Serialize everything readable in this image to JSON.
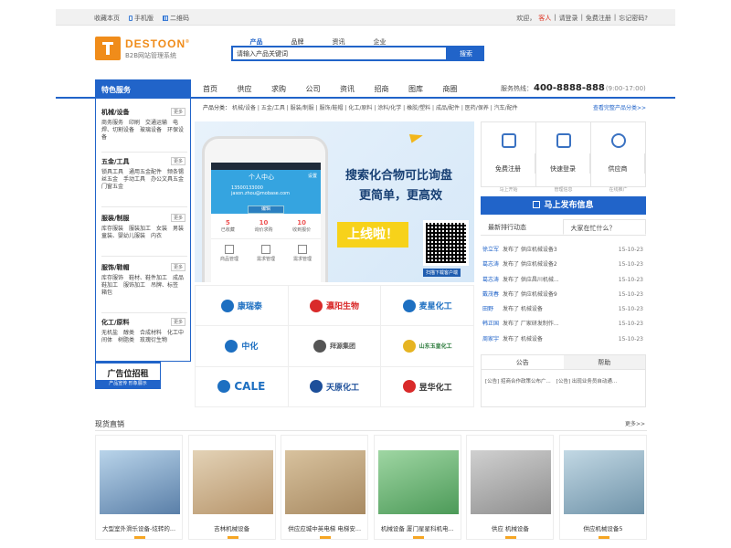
{
  "topbar": {
    "left": [
      "收藏本页",
      "手机版",
      "二维码"
    ],
    "welcome": "欢迎，",
    "guest": "客人",
    "links": [
      "请登录",
      "免费注册",
      "忘记密码?"
    ],
    "sep": "|"
  },
  "logo": {
    "name": "DESTOON",
    "reg": "®",
    "sub": "B2B网站管理系统"
  },
  "search": {
    "tabs": [
      "产品",
      "品牌",
      "资讯",
      "企业"
    ],
    "placeholder": "请输入产品关键词",
    "button": "搜索"
  },
  "nav": {
    "side_title": "特色服务",
    "items": [
      "首页",
      "供应",
      "求购",
      "公司",
      "资讯",
      "招商",
      "图库",
      "商圈"
    ],
    "hotline_label": "服务热线：",
    "hotline_number": "400-8888-888",
    "hotline_hours": "(9:00-17:00)"
  },
  "category_line": {
    "label": "产品分类：",
    "items": "机械/设备 | 五金/工具 | 服装/制服 | 服饰/鞋帽 | 化工/原料 | 涂料/化学 | 橡胶/塑料 | 成品/配件 | 医药/保养 | 汽车/配件",
    "all": "查看完整产品分类>>"
  },
  "sidebar": {
    "more": "更多",
    "cats": [
      {
        "title": "机械/设备",
        "items": "商务服务　印刷　交通运输　电焊、切割设备　玻璃设备　环保设备"
      },
      {
        "title": "五金/工具",
        "items": "锁具工具　通用五金配件　频条锡丝五金　手动工具　办公文具五金　门窗五金"
      },
      {
        "title": "服装/制服",
        "items": "库存服装　服装加工　女装　男装　童装、婴幼儿服装　内衣"
      },
      {
        "title": "服饰/鞋帽",
        "items": "库存服饰　鞋材、鞋件加工　成品鞋加工　服饰加工　吊牌、标签　箱包"
      },
      {
        "title": "化工/原料",
        "items": "无机盐　醇类　合成材料　化工中间体　树脂类　玫瑰衍生物"
      }
    ],
    "ad_title": "广告位招租",
    "ad_sub": "产品宣传 形象展示"
  },
  "banner": {
    "title": "搜索化合物可比询盘",
    "subtitle": "更简单，更高效",
    "online": "上线啦！",
    "phone_header": "个人中心",
    "phone_setting": "设置",
    "phone_user": "13500133000",
    "phone_email": "jason.zhou@mobase.com",
    "phone_edit": "编辑",
    "stats": [
      {
        "num": "5",
        "label": "已收藏"
      },
      {
        "num": "10",
        "label": "询价求购"
      },
      {
        "num": "10",
        "label": "收到报价"
      }
    ],
    "tiles": [
      "商品管理",
      "需求管理",
      "需求管理"
    ],
    "caption": "扫描下载客户端"
  },
  "brands": [
    {
      "name": "康瑞泰",
      "color": "#1d6fc1"
    },
    {
      "name": "瀛阳生物",
      "color": "#d92a2a"
    },
    {
      "name": "麦星化工",
      "color": "#1d6fc1"
    },
    {
      "name": "中化",
      "color": "#1d6fc1"
    },
    {
      "name": "拜源集团",
      "color": "#555555"
    },
    {
      "name": "山东玉皇化工",
      "color": "#2a7a3a"
    },
    {
      "name": "CALE",
      "color": "#1d6fc1"
    },
    {
      "name": "天原化工",
      "color": "#1d4f9a"
    },
    {
      "name": "昱华化工",
      "color": "#333333"
    }
  ],
  "quick": [
    {
      "t1": "免费注册",
      "t2": "马上开始"
    },
    {
      "t1": "快速登录",
      "t2": "管理信息"
    },
    {
      "t1": "供应商",
      "t2": "在线推广"
    }
  ],
  "publish": "马上发布信息",
  "tabs2": [
    "最新排行动态",
    "大家在忙什么？"
  ],
  "feed": [
    {
      "u": "徐立军",
      "m": "发布了 供应机械设备3",
      "d": "15-10-23"
    },
    {
      "u": "葛志涛",
      "m": "发布了 供应机械设备2",
      "d": "15-10-23"
    },
    {
      "u": "葛志涛",
      "m": "发布了 供应昌川机械...",
      "d": "15-10-23"
    },
    {
      "u": "戴茂春",
      "m": "发布了 供应机械设备9",
      "d": "15-10-23"
    },
    {
      "u": "田野",
      "m": "发布了 机械设备",
      "d": "15-10-23"
    },
    {
      "u": "韩正国",
      "m": "发布了 厂家研发制作...",
      "d": "15-10-23"
    },
    {
      "u": "周家宇",
      "m": "发布了 机械设备",
      "d": "15-10-23"
    }
  ],
  "notice": {
    "tabs": [
      "公告",
      "帮助"
    ],
    "items": [
      "[公告] 招商合作政策公布广...",
      "[公告] 出现业务员自动通..."
    ]
  },
  "goods": {
    "title": "现货直销",
    "more": "更多>>",
    "items": [
      {
        "cap": "大型室外滑乐设备-炫转的...",
        "color": "#5a7fa8"
      },
      {
        "cap": "吉林机械设备",
        "color": "#b7956b"
      },
      {
        "cap": "供应应城中英电梯 电梯安...",
        "color": "#a88a62"
      },
      {
        "cap": "机械设备 厦门星星科机电...",
        "color": "#4c9a58"
      },
      {
        "cap": "供应 机械设备",
        "color": "#8e8e8e"
      },
      {
        "cap": "供应机械设备5",
        "color": "#6f93a9"
      }
    ]
  },
  "colors": {
    "brand": "#2164c9",
    "logo": "#f08c1a"
  }
}
